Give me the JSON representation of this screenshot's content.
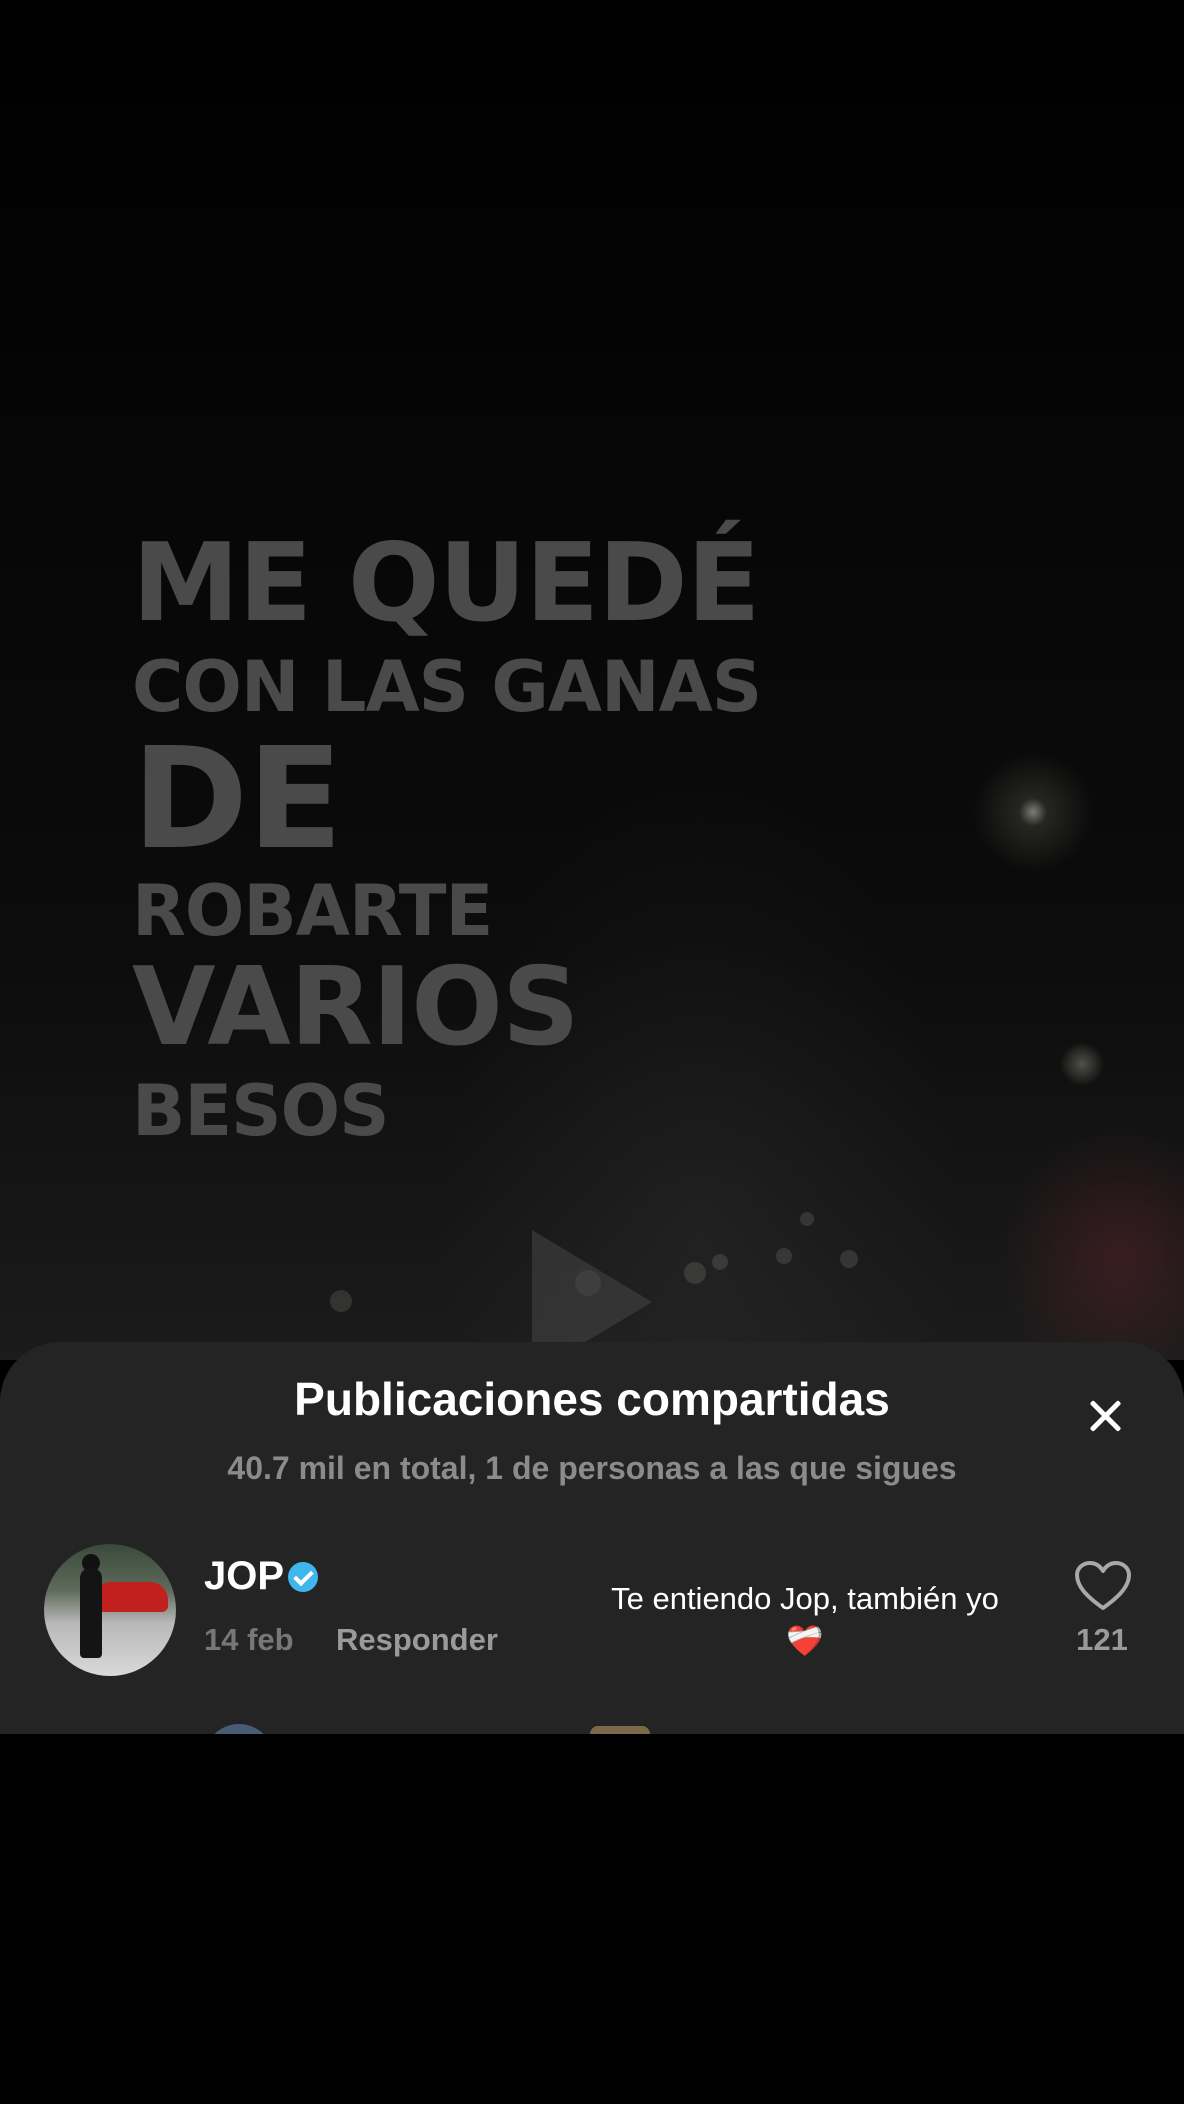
{
  "video": {
    "overlay_lines": [
      "ME QUEDÉ",
      "CON LAS GANAS",
      "DE",
      "ROBARTE",
      "VARIOS",
      "BESOS"
    ]
  },
  "sheet": {
    "title": "Publicaciones compartidas",
    "subtitle": "40.7 mil en total, 1 de personas a las que sigues"
  },
  "comments": [
    {
      "username": "JOP",
      "verified": true,
      "date": "14 feb",
      "reply_label": "Responder",
      "text": "Te entiendo Jop, también yo",
      "emoji": "❤️‍🩹",
      "likes": "121"
    }
  ],
  "colors": {
    "sheet_bg": "#242424",
    "verified": "#3fb6ec",
    "overlay_text": "#4a4a4a"
  },
  "icons": [
    "play-icon",
    "close-icon",
    "verified-icon",
    "heart-outline-icon"
  ]
}
